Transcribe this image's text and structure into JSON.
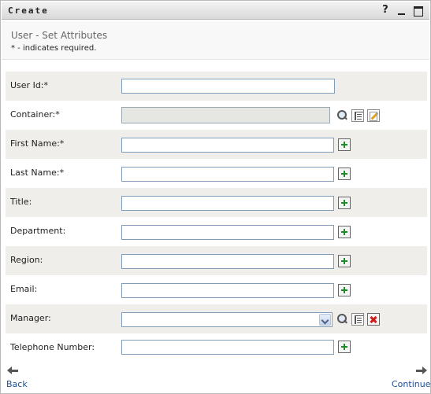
{
  "window": {
    "title": "Create",
    "help_label": "?",
    "min_label": "",
    "max_label": ""
  },
  "header": {
    "title": "User - Set Attributes",
    "note": "* - indicates required."
  },
  "fields": {
    "user_id": {
      "label": "User Id:*",
      "value": ""
    },
    "container": {
      "label": "Container:*",
      "value": ""
    },
    "first_name": {
      "label": "First Name:*",
      "value": ""
    },
    "last_name": {
      "label": "Last Name:*",
      "value": ""
    },
    "title": {
      "label": "Title:",
      "value": ""
    },
    "department": {
      "label": "Department:",
      "value": ""
    },
    "region": {
      "label": "Region:",
      "value": ""
    },
    "email": {
      "label": "Email:",
      "value": ""
    },
    "manager": {
      "label": "Manager:",
      "value": ""
    },
    "telephone": {
      "label": "Telephone Number:",
      "value": ""
    }
  },
  "nav": {
    "back_label": "Back",
    "continue_label": "Continue"
  },
  "icons": {
    "plus": "plus-icon",
    "search": "search-icon",
    "history": "history-icon",
    "edit": "edit-icon",
    "delete": "delete-icon",
    "dropdown": "chevron-down-icon",
    "back": "arrow-left-icon",
    "continue": "arrow-right-icon"
  },
  "colors": {
    "link": "#1b4f9c",
    "row_shade": "#efeeea",
    "plus_green": "#1f8a2a",
    "delete_red": "#d21a1a",
    "field_border": "#7f9db9"
  }
}
